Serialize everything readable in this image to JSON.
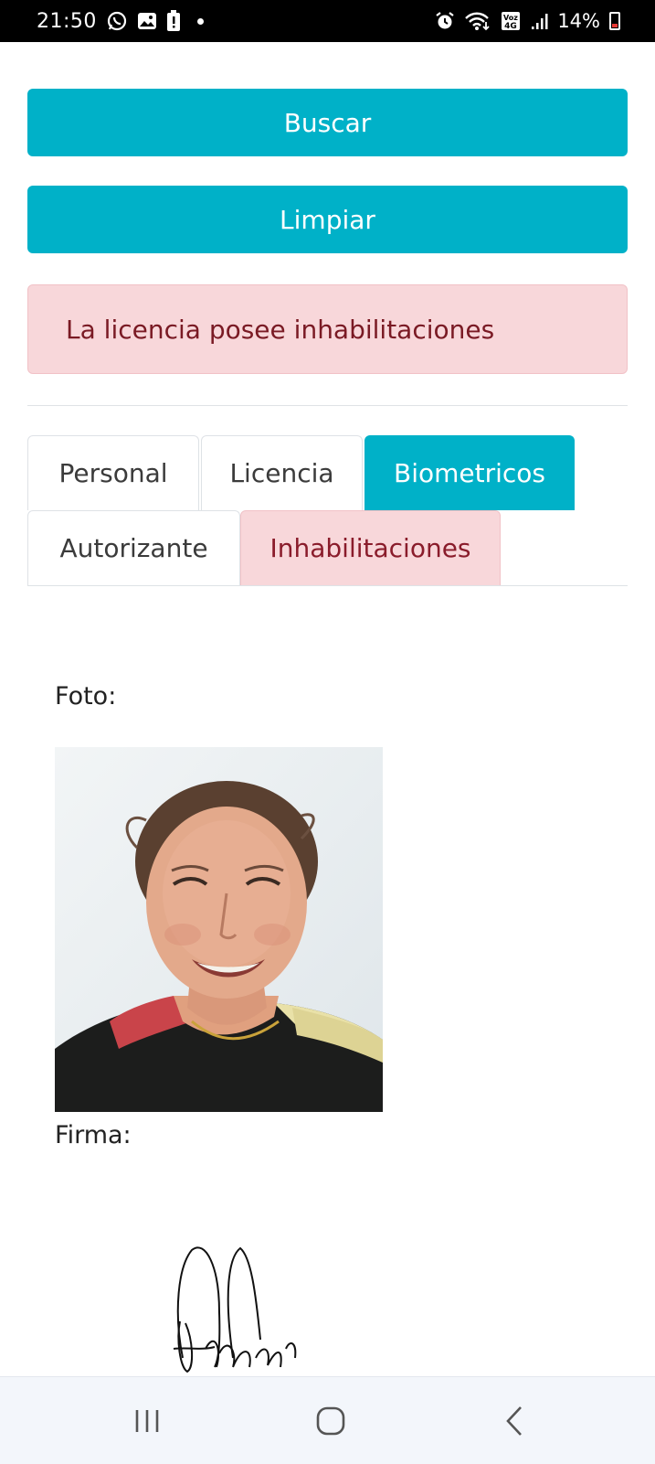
{
  "status_bar": {
    "time": "21:50",
    "battery_percent": "14%",
    "left_icons": [
      "whatsapp-icon",
      "gallery-icon",
      "battery-alert-icon",
      "dot-icon"
    ],
    "right_icons": [
      "alarm-icon",
      "wifi-icon",
      "volte-4g-icon",
      "signal-icon",
      "battery-icon"
    ]
  },
  "actions": {
    "search_label": "Buscar",
    "clear_label": "Limpiar"
  },
  "alert": {
    "message": "La licencia posee inhabilitaciones"
  },
  "tabs": [
    {
      "label": "Personal",
      "active": false
    },
    {
      "label": "Licencia",
      "active": false
    },
    {
      "label": "Biometricos",
      "active": true
    },
    {
      "label": "Autorizante",
      "active": false
    },
    {
      "label": "Inhabilitaciones",
      "active": false,
      "variant": "danger"
    }
  ],
  "biometrics": {
    "photo_label": "Foto:",
    "signature_label": "Firma:"
  },
  "colors": {
    "primary": "#00b1c8",
    "danger_bg": "#f8d7da",
    "danger_text": "#7a1a24"
  },
  "nav_bar": {
    "icons": [
      "recents-icon",
      "home-icon",
      "back-icon"
    ]
  }
}
